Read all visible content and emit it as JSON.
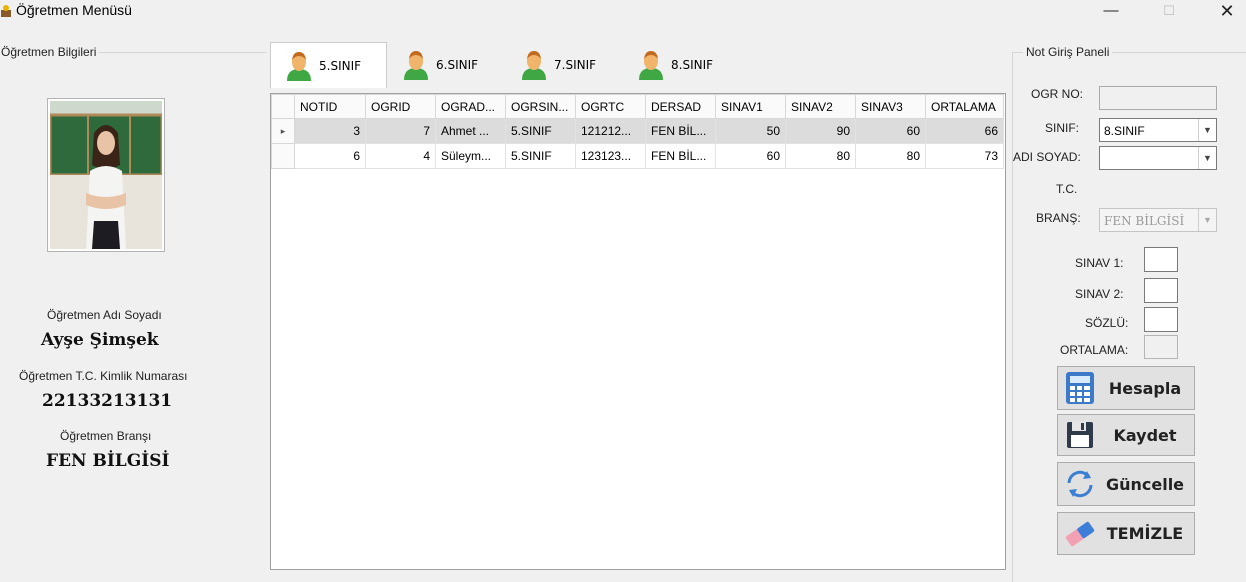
{
  "window": {
    "title": "Öğretmen Menüsü",
    "minimize": "—",
    "maximize": "☐",
    "close": "✕"
  },
  "teacher_panel": {
    "legend": "Öğretmen Bilgileri",
    "name_label": "Öğretmen Adı Soyadı",
    "name": "Ayşe Şimşek",
    "tc_label": "Öğretmen T.C. Kimlik Numarası",
    "tc": "22133213131",
    "branch_label": "Öğretmen Branşı",
    "branch": "FEN BİLGİSİ"
  },
  "tabs": [
    {
      "label": "5.SINIF",
      "active": true
    },
    {
      "label": "6.SINIF",
      "active": false
    },
    {
      "label": "7.SINIF",
      "active": false
    },
    {
      "label": "8.SINIF",
      "active": false
    }
  ],
  "grid": {
    "columns": [
      "NOTID",
      "OGRID",
      "OGRAD...",
      "OGRSIN...",
      "OGRTC",
      "DERSAD",
      "SINAV1",
      "SINAV2",
      "SINAV3",
      "ORTALAMA"
    ],
    "rows": [
      {
        "selected": true,
        "cells": [
          "3",
          "7",
          "Ahmet ...",
          "5.SINIF",
          "121212...",
          "FEN BİL...",
          "50",
          "90",
          "60",
          "66"
        ]
      },
      {
        "selected": false,
        "cells": [
          "6",
          "4",
          "Süleym...",
          "5.SINIF",
          "123123...",
          "FEN BİL...",
          "60",
          "80",
          "80",
          "73"
        ]
      }
    ]
  },
  "grade_panel": {
    "legend": "Not Giriş Paneli",
    "ogr_no_label": "OGR NO:",
    "ogr_no_value": "",
    "sinif_label": "SINIF:",
    "sinif_value": "8.SINIF",
    "ad_soyad_label": "ADI SOYAD:",
    "ad_soyad_value": "",
    "tc_label": "T.C.",
    "brans_label": "BRANŞ:",
    "brans_value": "FEN BİLGİSİ",
    "sinav1_label": "SINAV 1:",
    "sinav2_label": "SINAV 2:",
    "sozlu_label": "SÖZLÜ:",
    "ortalama_label": "ORTALAMA:"
  },
  "buttons": {
    "hesapla": "Hesapla",
    "kaydet": "Kaydet",
    "guncelle": "Güncelle",
    "temizle": "TEMİZLE"
  }
}
